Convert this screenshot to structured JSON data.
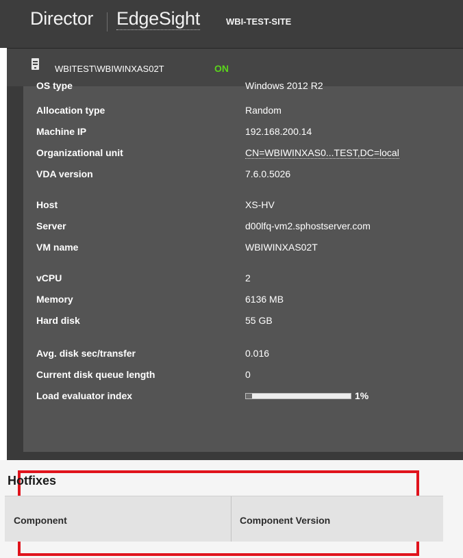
{
  "header": {
    "product_name": "Director",
    "secondary_product": "EdgeSight",
    "site_name": "WBI-TEST-SITE"
  },
  "machine": {
    "icon": "server-icon",
    "name": "WBITEST\\WBIWINXAS02T",
    "state": "ON",
    "state_color": "#5bd41c"
  },
  "details": {
    "os_type": {
      "label": "OS type",
      "value": "Windows 2012 R2"
    },
    "allocation_type": {
      "label": "Allocation type",
      "value": "Random"
    },
    "machine_ip": {
      "label": "Machine IP",
      "value": "192.168.200.14"
    },
    "organizational_unit": {
      "label": "Organizational unit",
      "value": "CN=WBIWINXAS0...TEST,DC=local"
    },
    "vda_version": {
      "label": "VDA version",
      "value": "7.6.0.5026"
    },
    "host": {
      "label": "Host",
      "value": "XS-HV"
    },
    "server": {
      "label": "Server",
      "value": "d00lfq-vm2.sphostserver.com"
    },
    "vm_name": {
      "label": "VM name",
      "value": "WBIWINXAS02T"
    },
    "vcpu": {
      "label": "vCPU",
      "value": "2"
    },
    "memory": {
      "label": "Memory",
      "value": "6136 MB"
    },
    "hard_disk": {
      "label": "Hard disk",
      "value": "55 GB"
    },
    "avg_disk_sec": {
      "label": "Avg. disk sec/transfer",
      "value": "0.016"
    },
    "disk_queue": {
      "label": "Current disk queue length",
      "value": "0"
    },
    "load_evaluator": {
      "label": "Load evaluator index",
      "value": "1%",
      "level_percent": 1
    }
  },
  "hotfixes": {
    "title": "Hotfixes",
    "columns": [
      "Component",
      "Component Version"
    ],
    "highlight_color": "#e0131c"
  }
}
